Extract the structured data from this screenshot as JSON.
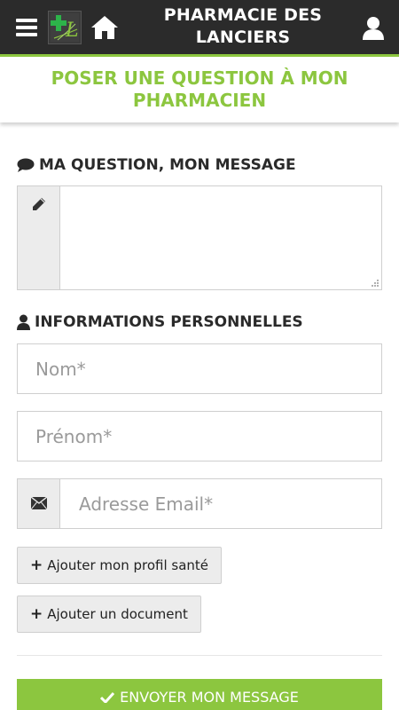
{
  "header": {
    "app_title": "PHARMACIE DES LANCIERS",
    "menu_icon": "hamburger-menu-icon",
    "logo_icon": "pharmacy-cross-logo",
    "home_icon": "home-icon",
    "user_icon": "user-icon"
  },
  "page": {
    "title": "POSER UNE QUESTION À MON PHARMACIEN"
  },
  "message_section": {
    "title": "MA QUESTION, MON MESSAGE",
    "icon": "comment-icon",
    "field_icon": "pencil-icon",
    "value": ""
  },
  "personal_section": {
    "title": "INFORMATIONS PERSONNELLES",
    "icon": "user-icon",
    "nom_placeholder": "Nom*",
    "prenom_placeholder": "Prénom*",
    "email_placeholder": "Adresse Email*",
    "email_icon": "envelope-icon"
  },
  "buttons": {
    "add_profile": "Ajouter mon profil santé",
    "add_document": "Ajouter un document",
    "submit": "ENVOYER MON MESSAGE"
  },
  "colors": {
    "accent": "#8cc63f",
    "topbar": "#2b2b2b"
  }
}
